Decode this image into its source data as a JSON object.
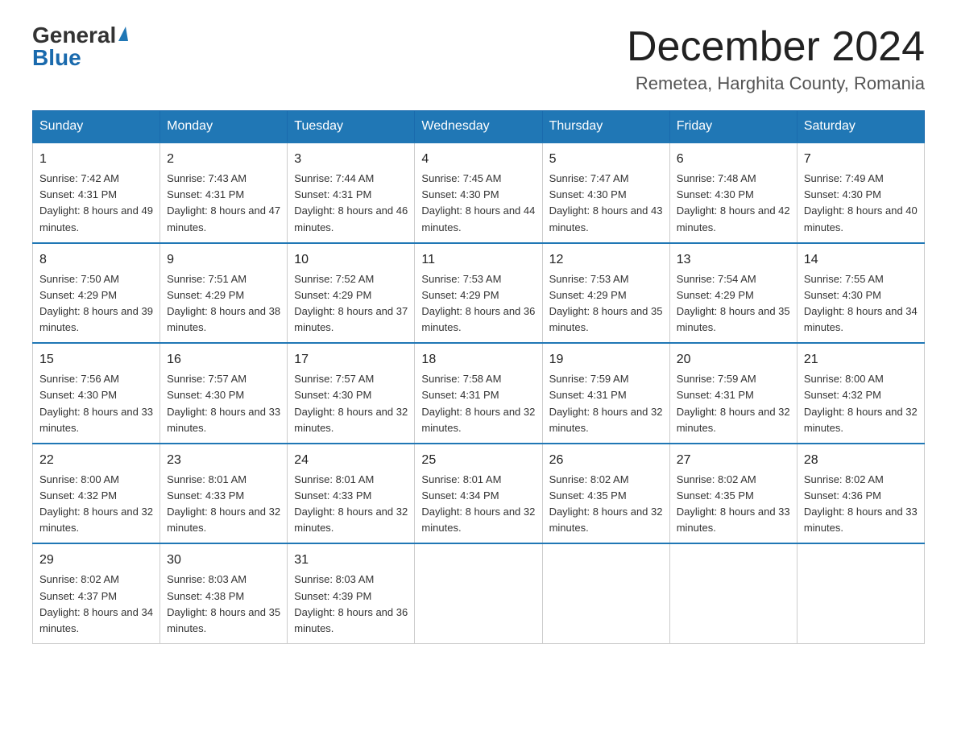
{
  "header": {
    "logo_general": "General",
    "logo_blue": "Blue",
    "month_title": "December 2024",
    "location": "Remetea, Harghita County, Romania"
  },
  "weekdays": [
    "Sunday",
    "Monday",
    "Tuesday",
    "Wednesday",
    "Thursday",
    "Friday",
    "Saturday"
  ],
  "weeks": [
    [
      {
        "day": "1",
        "sunrise": "7:42 AM",
        "sunset": "4:31 PM",
        "daylight": "8 hours and 49 minutes."
      },
      {
        "day": "2",
        "sunrise": "7:43 AM",
        "sunset": "4:31 PM",
        "daylight": "8 hours and 47 minutes."
      },
      {
        "day": "3",
        "sunrise": "7:44 AM",
        "sunset": "4:31 PM",
        "daylight": "8 hours and 46 minutes."
      },
      {
        "day": "4",
        "sunrise": "7:45 AM",
        "sunset": "4:30 PM",
        "daylight": "8 hours and 44 minutes."
      },
      {
        "day": "5",
        "sunrise": "7:47 AM",
        "sunset": "4:30 PM",
        "daylight": "8 hours and 43 minutes."
      },
      {
        "day": "6",
        "sunrise": "7:48 AM",
        "sunset": "4:30 PM",
        "daylight": "8 hours and 42 minutes."
      },
      {
        "day": "7",
        "sunrise": "7:49 AM",
        "sunset": "4:30 PM",
        "daylight": "8 hours and 40 minutes."
      }
    ],
    [
      {
        "day": "8",
        "sunrise": "7:50 AM",
        "sunset": "4:29 PM",
        "daylight": "8 hours and 39 minutes."
      },
      {
        "day": "9",
        "sunrise": "7:51 AM",
        "sunset": "4:29 PM",
        "daylight": "8 hours and 38 minutes."
      },
      {
        "day": "10",
        "sunrise": "7:52 AM",
        "sunset": "4:29 PM",
        "daylight": "8 hours and 37 minutes."
      },
      {
        "day": "11",
        "sunrise": "7:53 AM",
        "sunset": "4:29 PM",
        "daylight": "8 hours and 36 minutes."
      },
      {
        "day": "12",
        "sunrise": "7:53 AM",
        "sunset": "4:29 PM",
        "daylight": "8 hours and 35 minutes."
      },
      {
        "day": "13",
        "sunrise": "7:54 AM",
        "sunset": "4:29 PM",
        "daylight": "8 hours and 35 minutes."
      },
      {
        "day": "14",
        "sunrise": "7:55 AM",
        "sunset": "4:30 PM",
        "daylight": "8 hours and 34 minutes."
      }
    ],
    [
      {
        "day": "15",
        "sunrise": "7:56 AM",
        "sunset": "4:30 PM",
        "daylight": "8 hours and 33 minutes."
      },
      {
        "day": "16",
        "sunrise": "7:57 AM",
        "sunset": "4:30 PM",
        "daylight": "8 hours and 33 minutes."
      },
      {
        "day": "17",
        "sunrise": "7:57 AM",
        "sunset": "4:30 PM",
        "daylight": "8 hours and 32 minutes."
      },
      {
        "day": "18",
        "sunrise": "7:58 AM",
        "sunset": "4:31 PM",
        "daylight": "8 hours and 32 minutes."
      },
      {
        "day": "19",
        "sunrise": "7:59 AM",
        "sunset": "4:31 PM",
        "daylight": "8 hours and 32 minutes."
      },
      {
        "day": "20",
        "sunrise": "7:59 AM",
        "sunset": "4:31 PM",
        "daylight": "8 hours and 32 minutes."
      },
      {
        "day": "21",
        "sunrise": "8:00 AM",
        "sunset": "4:32 PM",
        "daylight": "8 hours and 32 minutes."
      }
    ],
    [
      {
        "day": "22",
        "sunrise": "8:00 AM",
        "sunset": "4:32 PM",
        "daylight": "8 hours and 32 minutes."
      },
      {
        "day": "23",
        "sunrise": "8:01 AM",
        "sunset": "4:33 PM",
        "daylight": "8 hours and 32 minutes."
      },
      {
        "day": "24",
        "sunrise": "8:01 AM",
        "sunset": "4:33 PM",
        "daylight": "8 hours and 32 minutes."
      },
      {
        "day": "25",
        "sunrise": "8:01 AM",
        "sunset": "4:34 PM",
        "daylight": "8 hours and 32 minutes."
      },
      {
        "day": "26",
        "sunrise": "8:02 AM",
        "sunset": "4:35 PM",
        "daylight": "8 hours and 32 minutes."
      },
      {
        "day": "27",
        "sunrise": "8:02 AM",
        "sunset": "4:35 PM",
        "daylight": "8 hours and 33 minutes."
      },
      {
        "day": "28",
        "sunrise": "8:02 AM",
        "sunset": "4:36 PM",
        "daylight": "8 hours and 33 minutes."
      }
    ],
    [
      {
        "day": "29",
        "sunrise": "8:02 AM",
        "sunset": "4:37 PM",
        "daylight": "8 hours and 34 minutes."
      },
      {
        "day": "30",
        "sunrise": "8:03 AM",
        "sunset": "4:38 PM",
        "daylight": "8 hours and 35 minutes."
      },
      {
        "day": "31",
        "sunrise": "8:03 AM",
        "sunset": "4:39 PM",
        "daylight": "8 hours and 36 minutes."
      },
      null,
      null,
      null,
      null
    ]
  ]
}
